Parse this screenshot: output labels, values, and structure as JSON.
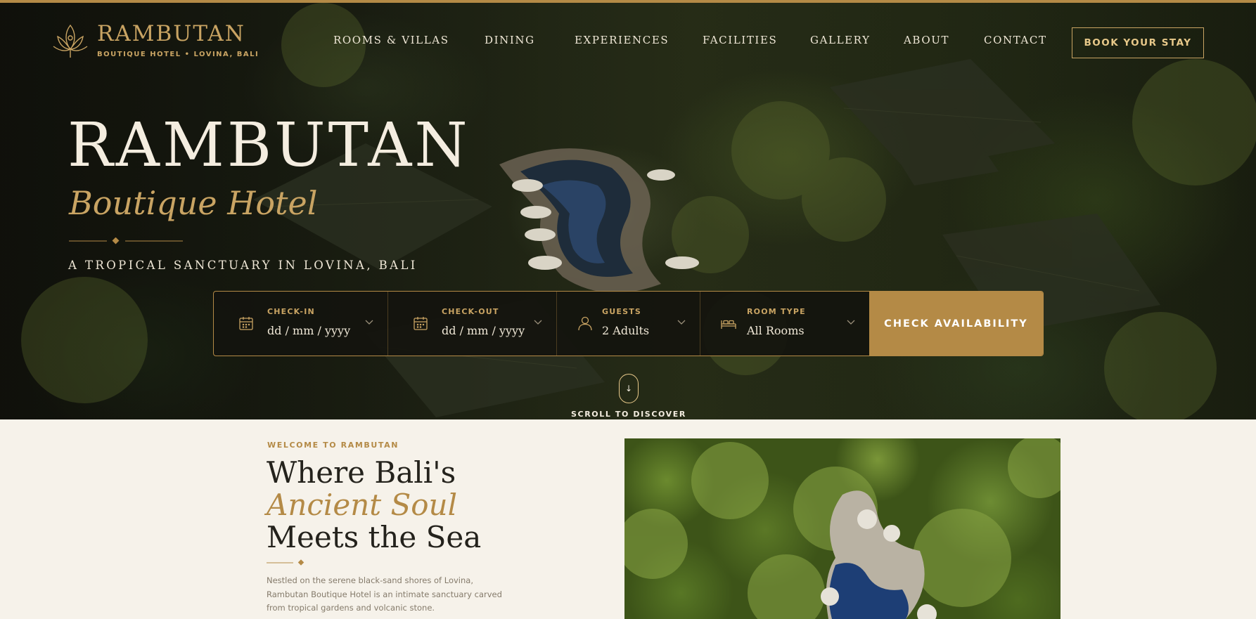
{
  "brand": {
    "name": "RAMBUTAN",
    "subtitle": "BOUTIQUE HOTEL • LOVINA, BALI",
    "logo_icon": "lotus-icon",
    "accent_color": "#b48a46"
  },
  "nav": {
    "items": [
      "ROOMS & VILLAS",
      "DINING",
      "EXPERIENCES",
      "FACILITIES",
      "GALLERY",
      "ABOUT",
      "CONTACT"
    ],
    "cta": "BOOK YOUR STAY"
  },
  "hero": {
    "title": "RAMBUTAN",
    "subtitle": "Boutique Hotel",
    "tagline": "A TROPICAL SANCTUARY IN LOVINA, BALI"
  },
  "booking": {
    "checkin": {
      "label": "CHECK-IN",
      "value": "dd / mm / yyyy",
      "icon": "calendar-icon"
    },
    "checkout": {
      "label": "CHECK-OUT",
      "value": "dd / mm / yyyy",
      "icon": "calendar-icon"
    },
    "guests": {
      "label": "GUESTS",
      "value": "2 Adults",
      "icon": "user-icon"
    },
    "room_type": {
      "label": "ROOM TYPE",
      "value": "All Rooms",
      "icon": "bed-icon"
    },
    "submit": "CHECK AVAILABILITY"
  },
  "scroll": {
    "label": "SCROLL TO DISCOVER",
    "icon": "arrow-down-icon"
  },
  "welcome": {
    "eyebrow": "WELCOME TO RAMBUTAN",
    "title_line1": "Where Bali's",
    "title_accent": "Ancient Soul",
    "title_line3": "Meets the Sea",
    "body": "Nestled on the serene black-sand shores of Lovina, Rambutan Boutique Hotel is an intimate sanctuary carved from tropical gardens and volcanic stone."
  }
}
